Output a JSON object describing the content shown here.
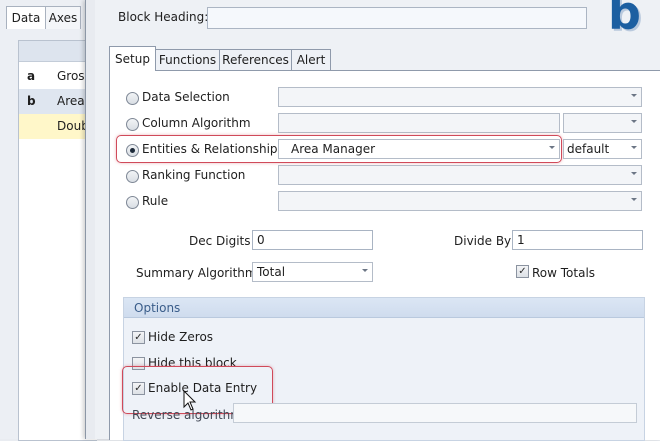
{
  "left_panel": {
    "tabs": [
      "Data",
      "Axes"
    ],
    "rows": [
      {
        "key": "a",
        "value": "Gros"
      },
      {
        "key": "b",
        "value": "Area"
      },
      {
        "key": "",
        "value": "Doub"
      }
    ]
  },
  "dialog": {
    "block_heading_label": "Block Heading:",
    "block_heading_value": "",
    "logo_letter": "b",
    "tabs": [
      "Setup",
      "Functions",
      "References",
      "Alert"
    ],
    "selected_tab": "Setup"
  },
  "setup": {
    "options": [
      {
        "label": "Data Selection",
        "selected": false,
        "value": "",
        "extra": ""
      },
      {
        "label": "Column Algorithm",
        "selected": false,
        "value": "",
        "extra": ""
      },
      {
        "label": "Entities & Relationships",
        "selected": true,
        "value": "Area Manager",
        "extra": "default"
      },
      {
        "label": "Ranking Function",
        "selected": false,
        "value": "",
        "extra": ""
      },
      {
        "label": "Rule",
        "selected": false,
        "value": "",
        "extra": ""
      }
    ],
    "dec_digits_label": "Dec Digits",
    "dec_digits_value": "0",
    "divide_by_label": "Divide By",
    "divide_by_value": "1",
    "summary_algorithm_label": "Summary Algorithm",
    "summary_algorithm_value": "Total",
    "row_totals_label": "Row Totals",
    "row_totals_checked": true
  },
  "options_group": {
    "title": "Options",
    "hide_zeros_label": "Hide Zeros",
    "hide_zeros_checked": true,
    "hide_block_label": "Hide this block",
    "hide_block_checked": false,
    "enable_data_entry_label": "Enable Data Entry",
    "enable_data_entry_checked": true,
    "reverse_algorithm_label": "Reverse algorithm",
    "reverse_algorithm_value": ""
  },
  "colors": {
    "accent_blue": "#1c5fa1",
    "highlight_red": "#d04a5a"
  }
}
